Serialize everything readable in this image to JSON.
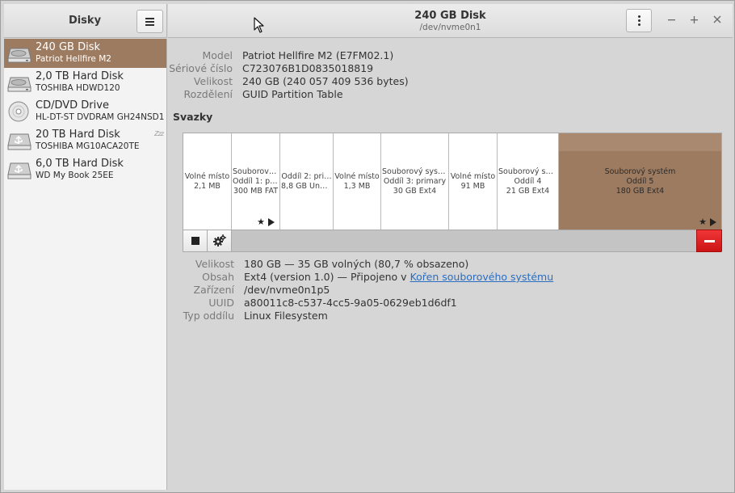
{
  "sidebar": {
    "title": "Disky",
    "drives": [
      {
        "name": "240 GB Disk",
        "model": "Patriot Hellfire M2",
        "icon": "hard-disk-icon",
        "selected": true
      },
      {
        "name": "2,0 TB Hard Disk",
        "model": "TOSHIBA HDWD120",
        "icon": "hard-disk-icon",
        "selected": false
      },
      {
        "name": "CD/DVD Drive",
        "model": "HL-DT-ST DVDRAM GH24NSD1",
        "icon": "optical-disc-icon",
        "selected": false
      },
      {
        "name": "20 TB Hard Disk",
        "model": "TOSHIBA MG10ACA20TE",
        "icon": "usb-drive-icon",
        "selected": false,
        "status": "Zzz"
      },
      {
        "name": "6,0 TB Hard Disk",
        "model": "WD My Book 25EE",
        "icon": "usb-drive-icon",
        "selected": false
      }
    ]
  },
  "header": {
    "title": "240 GB Disk",
    "subtitle": "/dev/nvme0n1"
  },
  "disk_info": {
    "model_label": "Model",
    "model_value": "Patriot Hellfire M2 (E7FM02.1)",
    "serial_label": "Sériové číslo",
    "serial_value": "C723076B1D0835018819",
    "size_label": "Velikost",
    "size_value": "240 GB (240 057 409 536 bytes)",
    "partitioning_label": "Rozdělení",
    "partitioning_value": "GUID Partition Table"
  },
  "volumes": {
    "title": "Svazky",
    "partitions": [
      {
        "line1": "Volné místo",
        "line2": "2,1 MB",
        "line3": ""
      },
      {
        "line1": "Souborový…",
        "line2": "Oddíl 1: pr…",
        "line3": "300 MB FAT",
        "marks": true
      },
      {
        "line1": "Oddíl 2: pri…",
        "line2": "8,8 GB Unkn…",
        "line3": ""
      },
      {
        "line1": "Volné místo",
        "line2": "1,3 MB",
        "line3": ""
      },
      {
        "line1": "Souborový syst…",
        "line2": "Oddíl 3: primary",
        "line3": "30 GB Ext4"
      },
      {
        "line1": "Volné místo",
        "line2": "91 MB",
        "line3": ""
      },
      {
        "line1": "Souborový sy…",
        "line2": "Oddíl 4",
        "line3": "21 GB Ext4"
      },
      {
        "line1": "Souborový systém",
        "line2": "Oddíl 5",
        "line3": "180 GB Ext4",
        "selected": true,
        "marks": true
      }
    ]
  },
  "selected_volume": {
    "size_label": "Velikost",
    "size_value": "180 GB — 35 GB volných (80,7 % obsazeno)",
    "content_label": "Obsah",
    "content_value": "Ext4 (version 1.0) — Připojeno v ",
    "content_link": "Kořen souborového systému",
    "device_label": "Zařízení",
    "device_value": "/dev/nvme0n1p5",
    "uuid_label": "UUID",
    "uuid_value": "a80011c8-c537-4cc5-9a05-0629eb1d6df1",
    "type_label": "Typ oddílu",
    "type_value": "Linux Filesystem"
  },
  "colors": {
    "selection": "#9c7b60",
    "delete": "#dd1f1f",
    "link": "#2a6ec2"
  }
}
